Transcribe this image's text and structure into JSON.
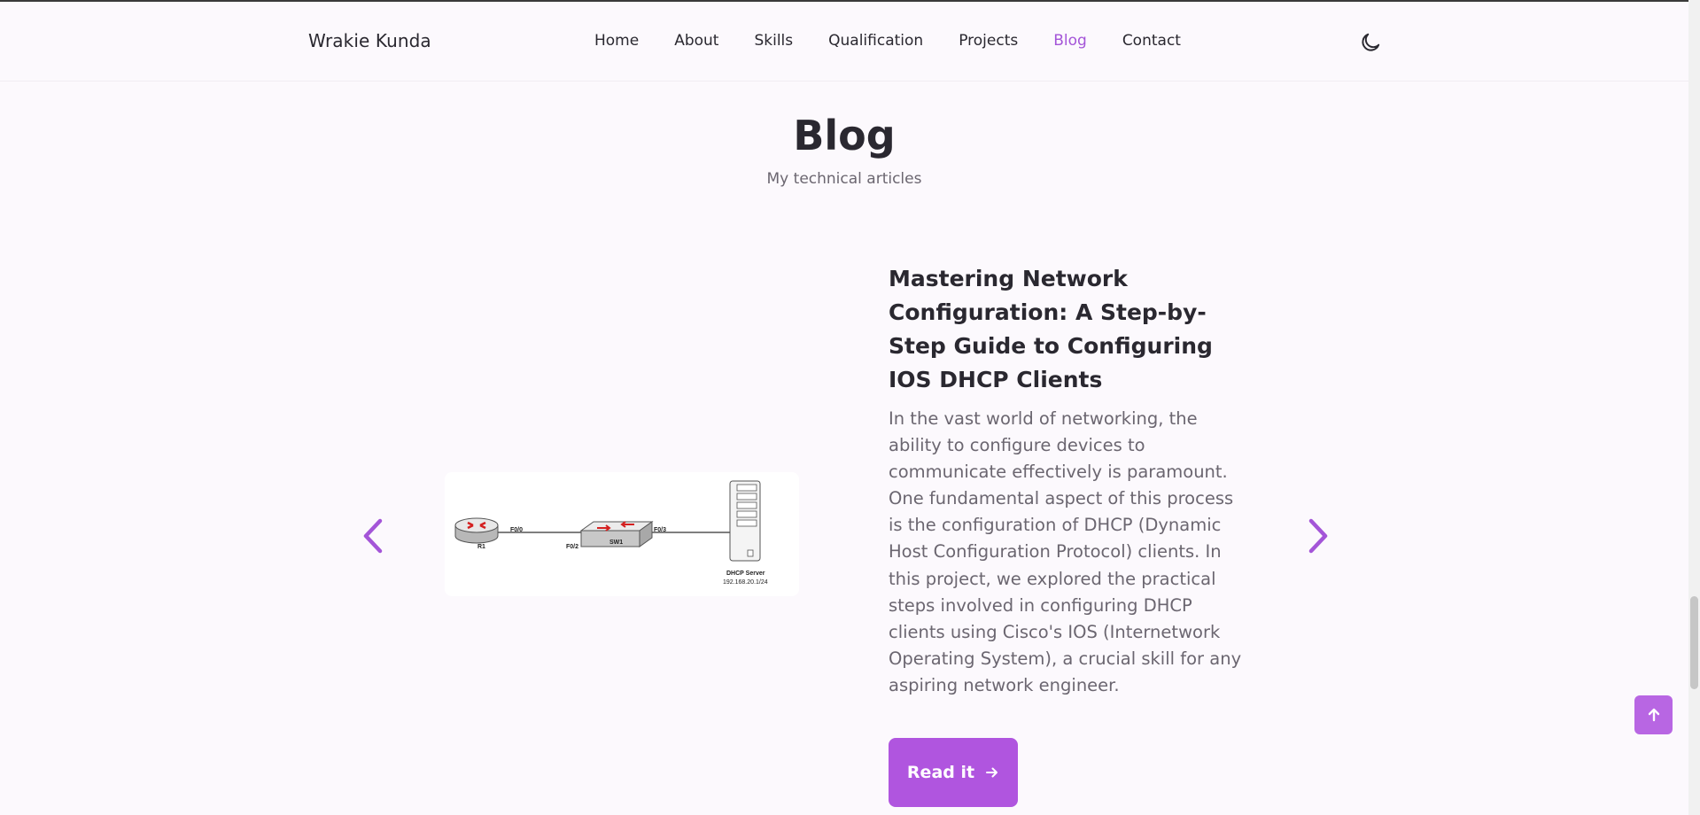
{
  "header": {
    "logo": "Wrakie Kunda",
    "nav": [
      {
        "label": "Home"
      },
      {
        "label": "About"
      },
      {
        "label": "Skills"
      },
      {
        "label": "Qualification"
      },
      {
        "label": "Projects"
      },
      {
        "label": "Blog",
        "active": true
      },
      {
        "label": "Contact"
      }
    ],
    "theme_icon": "moon-icon"
  },
  "section": {
    "title": "Blog",
    "subtitle": "My technical articles"
  },
  "post": {
    "title": "Mastering Network Configuration: A Step-by-Step Guide to Configuring IOS DHCP Clients",
    "description": "In the vast world of networking, the ability to configure devices to communicate effectively is paramount. One fundamental aspect of this process is the configuration of DHCP (Dynamic Host Configuration Protocol) clients. In this project, we explored the practical steps involved in configuring DHCP clients using Cisco's IOS (Internetwork Operating System), a crucial skill for any aspiring network engineer.",
    "button_label": "Read it",
    "diagram": {
      "router_label": "R1",
      "switch_label": "SW1",
      "port_router": "F0/0",
      "port_switch_left": "F0/2",
      "port_switch_right": "F0/3",
      "server_name": "DHCP Server",
      "server_ip": "192.168.20.1/24"
    }
  },
  "colors": {
    "accent": "#b055df",
    "active_nav": "#a455d8",
    "background": "#fcf9fd"
  }
}
